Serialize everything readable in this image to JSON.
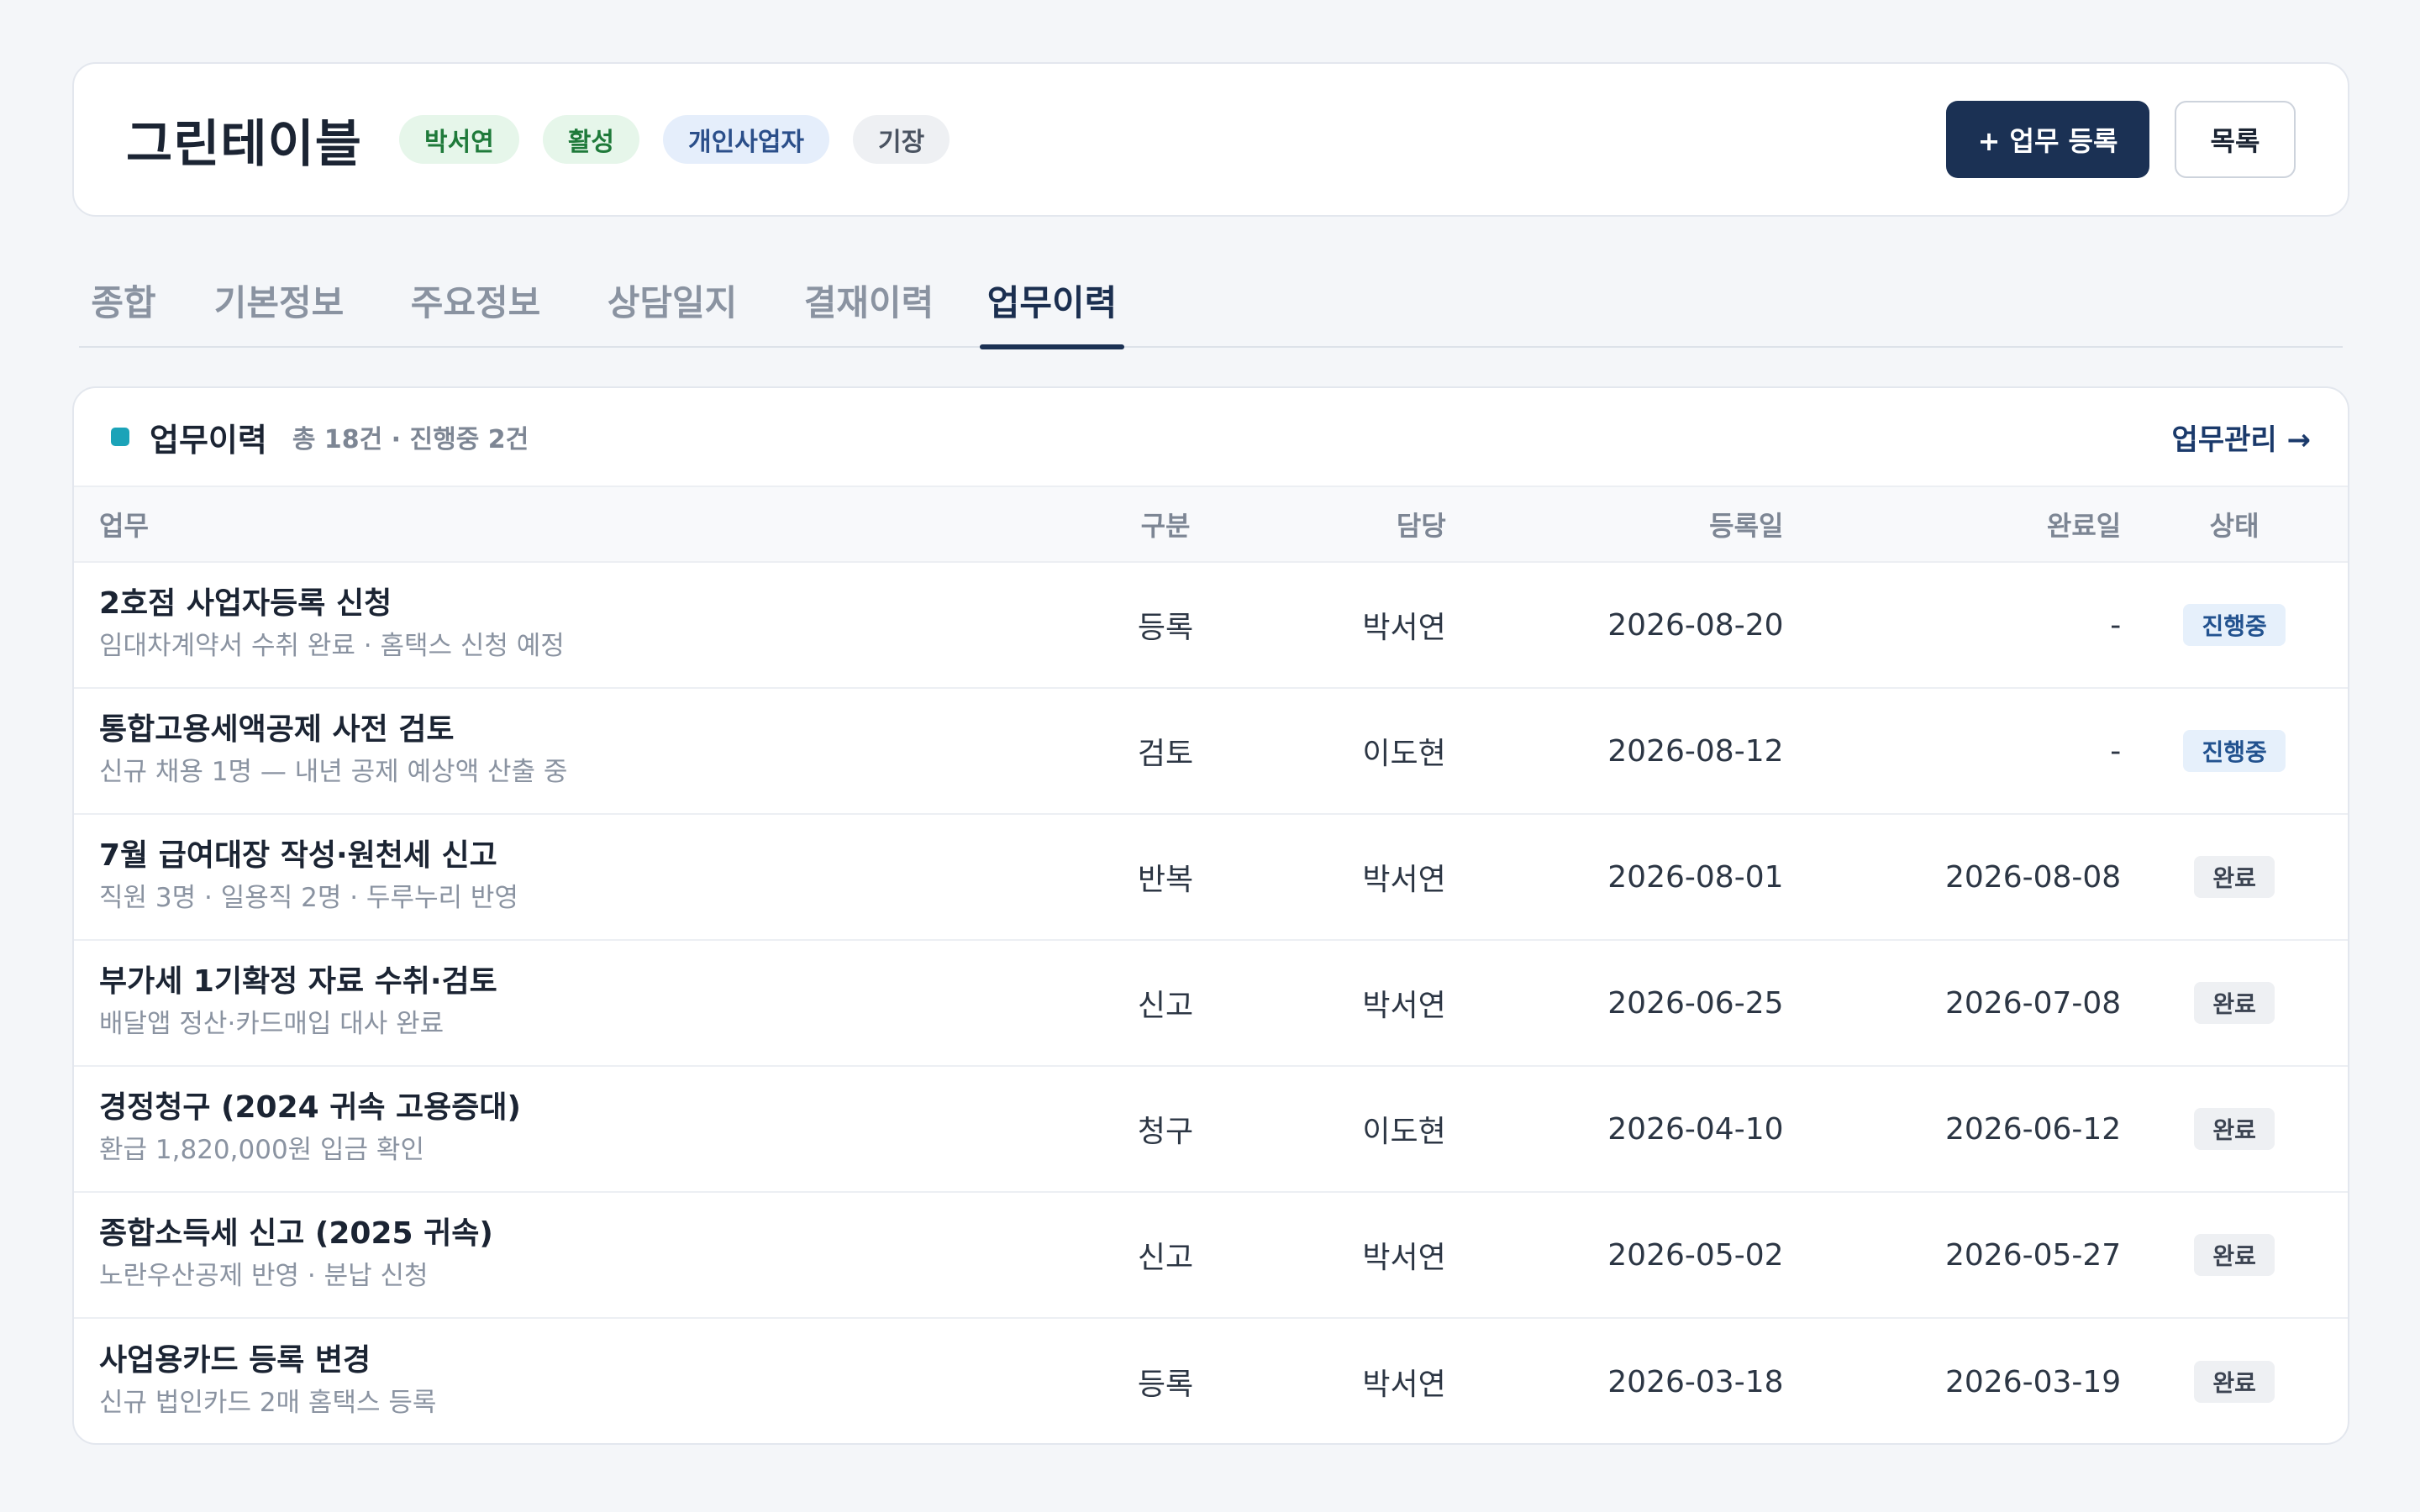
{
  "header": {
    "client_name": "그린테이블",
    "badges": [
      {
        "label": "박서연",
        "tone": "green"
      },
      {
        "label": "활성",
        "tone": "green"
      },
      {
        "label": "개인사업자",
        "tone": "blue"
      },
      {
        "label": "기장",
        "tone": "gray"
      }
    ],
    "add_task_label": "+ 업무 등록",
    "list_label": "목록"
  },
  "tabs": [
    {
      "label": "종합",
      "active": false
    },
    {
      "label": "기본정보",
      "active": false
    },
    {
      "label": "주요정보",
      "active": false
    },
    {
      "label": "상담일지",
      "active": false
    },
    {
      "label": "결재이력",
      "active": false
    },
    {
      "label": "업무이력",
      "active": true
    }
  ],
  "section": {
    "title": "업무이력",
    "summary": "총 18건 · 진행중 2건",
    "manage_link": "업무관리 →",
    "accent_color": "#1ba3b8"
  },
  "table": {
    "columns": {
      "task": "업무",
      "type": "구분",
      "owner": "담당",
      "registered": "등록일",
      "completed": "완료일",
      "status": "상태"
    },
    "rows": [
      {
        "title": "2호점 사업자등록 신청",
        "subtitle": "임대차계약서 수취 완료 · 홈택스 신청 예정",
        "type": "등록",
        "owner": "박서연",
        "registered": "2026-08-20",
        "completed": "-",
        "status": "진행중",
        "status_tone": "progress"
      },
      {
        "title": "통합고용세액공제 사전 검토",
        "subtitle": "신규 채용 1명 — 내년 공제 예상액 산출 중",
        "type": "검토",
        "owner": "이도현",
        "registered": "2026-08-12",
        "completed": "-",
        "status": "진행중",
        "status_tone": "progress"
      },
      {
        "title": "7월 급여대장 작성·원천세 신고",
        "subtitle": "직원 3명 · 일용직 2명 · 두루누리 반영",
        "type": "반복",
        "owner": "박서연",
        "registered": "2026-08-01",
        "completed": "2026-08-08",
        "status": "완료",
        "status_tone": "done"
      },
      {
        "title": "부가세 1기확정 자료 수취·검토",
        "subtitle": "배달앱 정산·카드매입 대사 완료",
        "type": "신고",
        "owner": "박서연",
        "registered": "2026-06-25",
        "completed": "2026-07-08",
        "status": "완료",
        "status_tone": "done"
      },
      {
        "title": "경정청구 (2024 귀속 고용증대)",
        "subtitle": "환급 1,820,000원 입금 확인",
        "type": "청구",
        "owner": "이도현",
        "registered": "2026-04-10",
        "completed": "2026-06-12",
        "status": "완료",
        "status_tone": "done"
      },
      {
        "title": "종합소득세 신고 (2025 귀속)",
        "subtitle": "노란우산공제 반영 · 분납 신청",
        "type": "신고",
        "owner": "박서연",
        "registered": "2026-05-02",
        "completed": "2026-05-27",
        "status": "완료",
        "status_tone": "done"
      },
      {
        "title": "사업용카드 등록 변경",
        "subtitle": "신규 법인카드 2매 홈택스 등록",
        "type": "등록",
        "owner": "박서연",
        "registered": "2026-03-18",
        "completed": "2026-03-19",
        "status": "완료",
        "status_tone": "done"
      }
    ]
  }
}
